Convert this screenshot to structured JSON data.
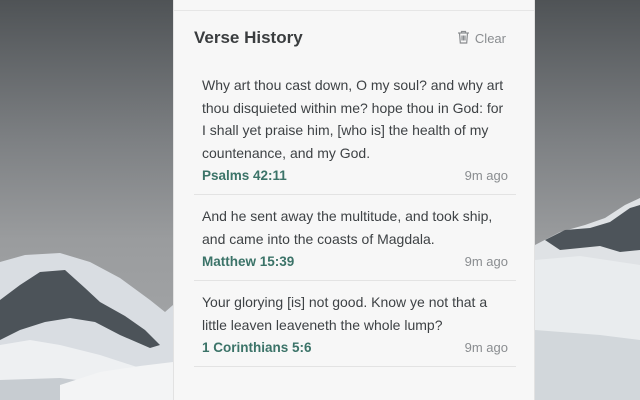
{
  "panel": {
    "title": "Verse History",
    "clear_label": "Clear"
  },
  "history": [
    {
      "text": "Why art thou cast down, O my soul? and why art thou disquieted within me? hope thou in God: for I shall yet praise him, [who is] the health of my countenance, and my God.",
      "reference": "Psalms 42:11",
      "time": "9m ago"
    },
    {
      "text": "And he sent away the multitude, and took ship, and came into the coasts of Magdala.",
      "reference": "Matthew 15:39",
      "time": "9m ago"
    },
    {
      "text": "Your glorying [is] not good. Know ye not that a little leaven leaveneth the whole lump?",
      "reference": "1 Corinthians 5:6",
      "time": "9m ago"
    }
  ],
  "colors": {
    "reference_accent": "#3b7368",
    "panel_background": "#f7f7f7"
  },
  "icons": {
    "clear": "trash-icon"
  }
}
